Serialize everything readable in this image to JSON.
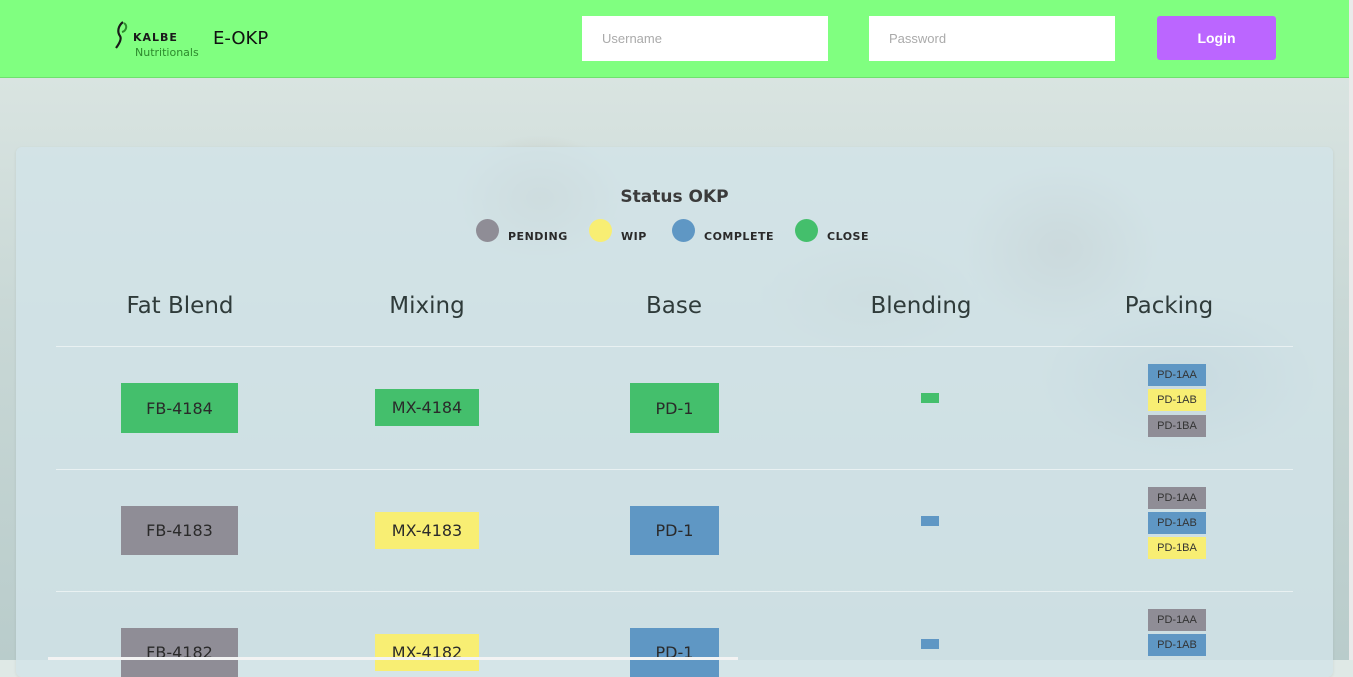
{
  "colors": {
    "pending": "#8f8d96",
    "wip": "#f8ee73",
    "complete": "#5f97c4",
    "close": "#44bf6c",
    "header_bg": "#80ff80",
    "login_bg": "#bb66ff"
  },
  "header": {
    "logo_brand": "KALBE",
    "logo_sub": "Nutritionals",
    "app_title": "E-OKP",
    "username_placeholder": "Username",
    "password_placeholder": "Password",
    "login_label": "Login"
  },
  "status": {
    "title": "Status OKP",
    "legend": [
      {
        "label": "PENDING",
        "status": "pending"
      },
      {
        "label": "WIP",
        "status": "wip"
      },
      {
        "label": "COMPLETE",
        "status": "complete"
      },
      {
        "label": "CLOSE",
        "status": "close"
      }
    ]
  },
  "columns": [
    "Fat Blend",
    "Mixing",
    "Base",
    "Blending",
    "Packing"
  ],
  "rows": [
    {
      "fat_blend": {
        "label": "FB-4184",
        "status": "close"
      },
      "mixing": {
        "label": "MX-4184",
        "status": "close"
      },
      "base": {
        "label": "PD-1",
        "status": "close"
      },
      "blending": {
        "status": "close"
      },
      "packing": [
        {
          "label": "PD-1AA",
          "status": "complete"
        },
        {
          "label": "PD-1AB",
          "status": "wip"
        },
        {
          "label": "PD-1BA",
          "status": "pending"
        }
      ]
    },
    {
      "fat_blend": {
        "label": "FB-4183",
        "status": "pending"
      },
      "mixing": {
        "label": "MX-4183",
        "status": "wip"
      },
      "base": {
        "label": "PD-1",
        "status": "complete"
      },
      "blending": {
        "status": "complete"
      },
      "packing": [
        {
          "label": "PD-1AA",
          "status": "pending"
        },
        {
          "label": "PD-1AB",
          "status": "complete"
        },
        {
          "label": "PD-1BA",
          "status": "wip"
        }
      ]
    },
    {
      "fat_blend": {
        "label": "FB-4182",
        "status": "pending"
      },
      "mixing": {
        "label": "MX-4182",
        "status": "wip"
      },
      "base": {
        "label": "PD-1",
        "status": "complete"
      },
      "blending": {
        "status": "complete"
      },
      "packing": [
        {
          "label": "PD-1AA",
          "status": "pending"
        },
        {
          "label": "PD-1AB",
          "status": "complete"
        }
      ]
    }
  ]
}
